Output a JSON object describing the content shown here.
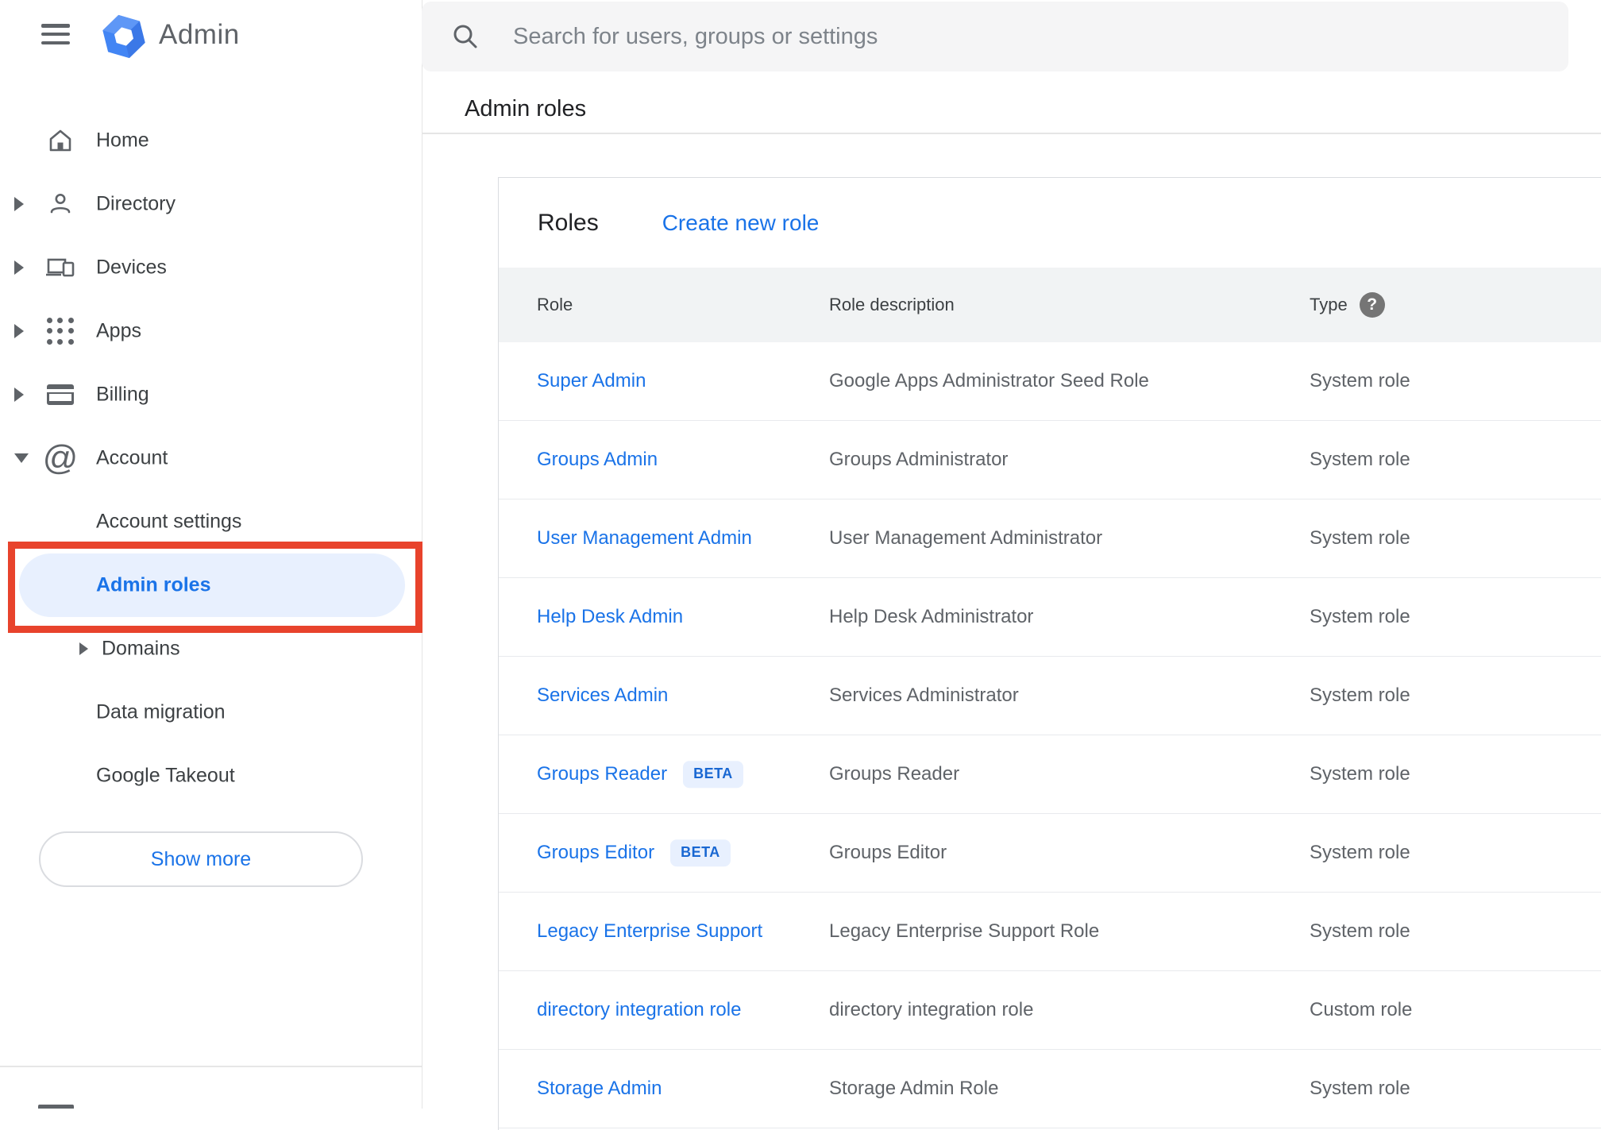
{
  "header": {
    "app_name": "Admin",
    "search_placeholder": "Search for users, groups or settings"
  },
  "breadcrumb": {
    "title": "Admin roles"
  },
  "sidebar": {
    "items": [
      {
        "label": "Home"
      },
      {
        "label": "Directory"
      },
      {
        "label": "Devices"
      },
      {
        "label": "Apps"
      },
      {
        "label": "Billing"
      },
      {
        "label": "Account"
      }
    ],
    "submenu": [
      {
        "label": "Account settings"
      },
      {
        "label": "Admin roles",
        "selected": true
      },
      {
        "label": "Domains"
      },
      {
        "label": "Data migration"
      },
      {
        "label": "Google Takeout"
      }
    ],
    "show_more": "Show more",
    "at_glyph": "@"
  },
  "card": {
    "title": "Roles",
    "create_link": "Create new role",
    "columns": {
      "role": "Role",
      "description": "Role description",
      "type": "Type"
    },
    "help_glyph": "?",
    "rows": [
      {
        "role": "Super Admin",
        "badge": "",
        "description": "Google Apps Administrator Seed Role",
        "type": "System role"
      },
      {
        "role": "Groups Admin",
        "badge": "",
        "description": "Groups Administrator",
        "type": "System role"
      },
      {
        "role": "User Management Admin",
        "badge": "",
        "description": "User Management Administrator",
        "type": "System role"
      },
      {
        "role": "Help Desk Admin",
        "badge": "",
        "description": "Help Desk Administrator",
        "type": "System role"
      },
      {
        "role": "Services Admin",
        "badge": "",
        "description": "Services Administrator",
        "type": "System role"
      },
      {
        "role": "Groups Reader",
        "badge": "BETA",
        "description": "Groups Reader",
        "type": "System role"
      },
      {
        "role": "Groups Editor",
        "badge": "BETA",
        "description": "Groups Editor",
        "type": "System role"
      },
      {
        "role": "Legacy Enterprise Support",
        "badge": "",
        "description": "Legacy Enterprise Support Role",
        "type": "System role"
      },
      {
        "role": "directory integration role",
        "badge": "",
        "description": "directory integration role",
        "type": "Custom role"
      },
      {
        "role": "Storage Admin",
        "badge": "",
        "description": "Storage Admin Role",
        "type": "System role"
      }
    ]
  },
  "colors": {
    "accent_blue": "#1a73e8",
    "annotation_red": "#e8432c",
    "badge_bg": "#e8f0fe",
    "badge_text": "#1967d2",
    "table_header_bg": "#f1f3f4",
    "muted_text": "#5f6368"
  }
}
